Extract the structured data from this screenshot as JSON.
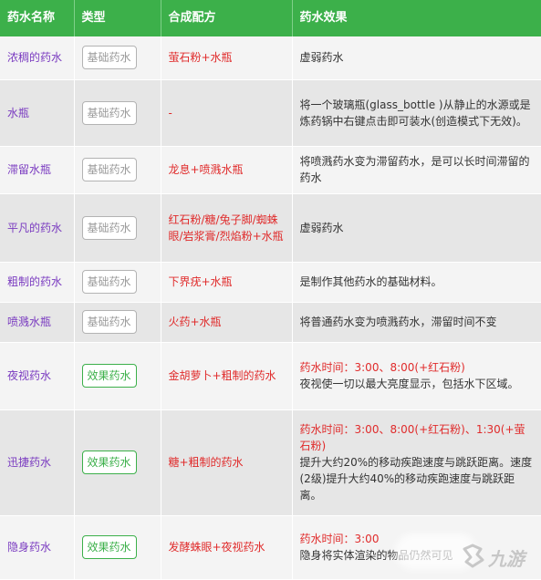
{
  "header": {
    "col_name": "药水名称",
    "col_type": "类型",
    "col_recipe": "合成配方",
    "col_effect": "药水效果"
  },
  "rows": [
    {
      "name": "浓稠的药水",
      "type": "基础药水",
      "recipe": "萤石粉+水瓶",
      "duration": "",
      "effect": "虚弱药水"
    },
    {
      "name": "水瓶",
      "type": "基础药水",
      "recipe": "-",
      "duration": "",
      "effect": "将一个玻璃瓶(glass_bottle )从静止的水源或是炼药锅中右键点击即可装水(创造模式下无效)。"
    },
    {
      "name": "滞留水瓶",
      "type": "基础药水",
      "recipe": "龙息+喷溅水瓶",
      "duration": "",
      "effect": "将喷溅药水变为滞留药水，是可以长时间滞留的药水"
    },
    {
      "name": "平凡的药水",
      "type": "基础药水",
      "recipe": "红石粉/糖/兔子脚/蜘蛛眼/岩浆膏/烈焰粉+水瓶",
      "duration": "",
      "effect": "虚弱药水"
    },
    {
      "name": "粗制的药水",
      "type": "基础药水",
      "recipe": "下界疣+水瓶",
      "duration": "",
      "effect": "是制作其他药水的基础材料。"
    },
    {
      "name": "喷溅水瓶",
      "type": "基础药水",
      "recipe": "火药+水瓶",
      "duration": "",
      "effect": "将普通药水变为喷溅药水，滞留时间不变"
    },
    {
      "name": "夜视药水",
      "type": "效果药水",
      "recipe": "金胡萝卜+粗制的药水",
      "duration": "药水时间：3:00、8:00(+红石粉)",
      "effect": "夜视使一切以最大亮度显示，包括水下区域。"
    },
    {
      "name": "迅捷药水",
      "type": "效果药水",
      "recipe": "糖+粗制的药水",
      "duration": "药水时间：3:00、8:00(+红石粉)、1:30(+萤石粉)",
      "effect": "提升大约20%的移动疾跑速度与跳跃距离。速度(2级)提升大约40%的移动疾跑速度与跳跃距离。"
    },
    {
      "name": "隐身药水",
      "type": "效果药水",
      "recipe": "发酵蛛眼+夜视药水",
      "duration": "药水时间：3:00",
      "effect": "隐身将实体渲染的物品仍然可见"
    }
  ],
  "watermark": {
    "text": "九游",
    "icon": "jiuyou-logo-icon"
  }
}
